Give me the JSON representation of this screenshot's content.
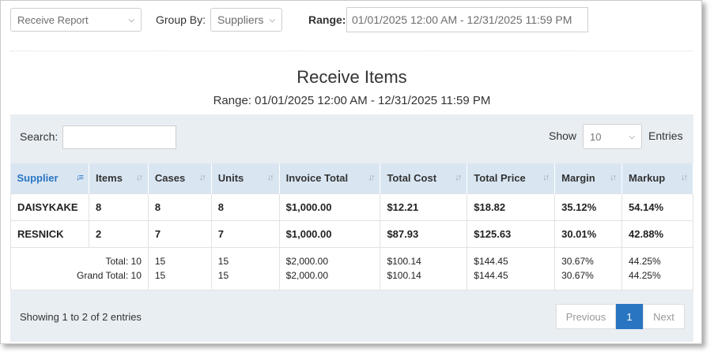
{
  "toolbar": {
    "report_select": "Receive Report",
    "group_by_label": "Group By:",
    "group_by_value": "Suppliers",
    "range_label": "Range:",
    "range_value": "01/01/2025 12:00 AM - 12/31/2025 11:59 PM"
  },
  "report": {
    "title": "Receive Items",
    "subtitle": "Range: 01/01/2025 12:00 AM - 12/31/2025 11:59 PM"
  },
  "table_controls": {
    "search_label": "Search:",
    "search_value": "",
    "show_label": "Show",
    "entries_value": "10",
    "entries_label": "Entries"
  },
  "table": {
    "columns": [
      "Supplier",
      "Items",
      "Cases",
      "Units",
      "Invoice Total",
      "Total Cost",
      "Total Price",
      "Margin",
      "Markup"
    ],
    "rows": [
      [
        "DAISYKAKE",
        "8",
        "8",
        "8",
        "$1,000.00",
        "$12.21",
        "$18.82",
        "35.12%",
        "54.14%"
      ],
      [
        "RESNICK",
        "2",
        "7",
        "7",
        "$1,000.00",
        "$87.93",
        "$125.63",
        "30.01%",
        "42.88%"
      ]
    ],
    "totals": {
      "total_label": "Total: 10",
      "grand_total_label": "Grand Total: 10",
      "total": [
        "15",
        "15",
        "$2,000.00",
        "$100.14",
        "$144.45",
        "30.67%",
        "44.25%"
      ],
      "grand_total": [
        "15",
        "15",
        "$2,000.00",
        "$100.14",
        "$144.45",
        "30.67%",
        "44.25%"
      ]
    }
  },
  "footer": {
    "showing": "Showing 1 to 2 of 2 entries",
    "previous": "Previous",
    "current_page": "1",
    "next": "Next"
  },
  "colors": {
    "accent": "#2a75c2",
    "header_bg": "#d9e6f2",
    "panel_bg": "#e9eef3"
  }
}
